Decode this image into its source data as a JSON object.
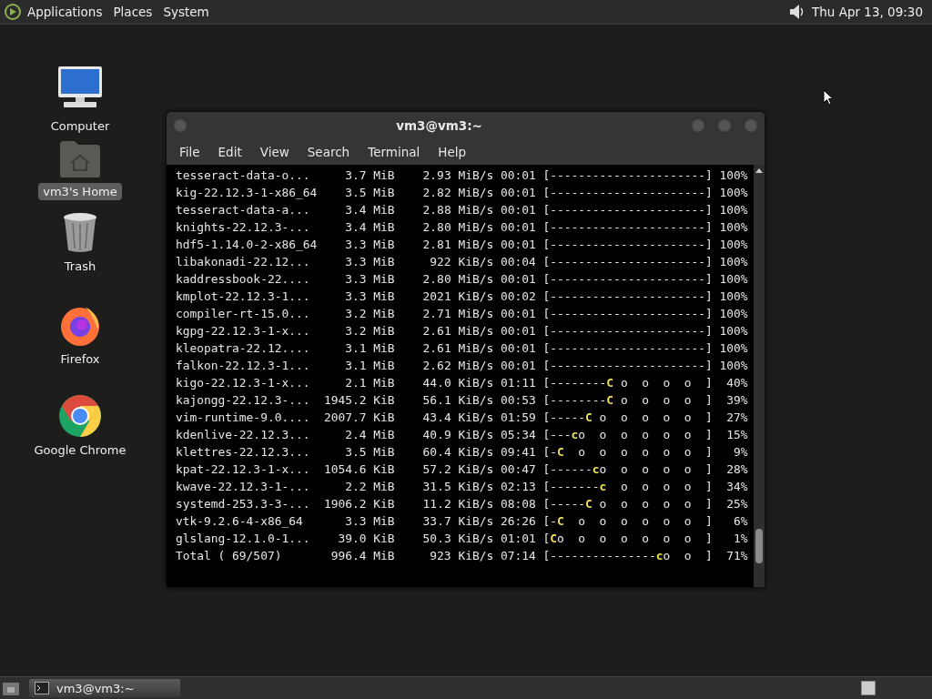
{
  "top_panel": {
    "menus": [
      "Applications",
      "Places",
      "System"
    ],
    "clock": "Thu Apr 13, 09:30"
  },
  "desktop_icons": [
    {
      "kind": "computer",
      "label": "Computer",
      "selected": false
    },
    {
      "kind": "home",
      "label": "vm3's Home",
      "selected": true
    },
    {
      "kind": "trash",
      "label": "Trash",
      "selected": false
    },
    {
      "kind": "firefox",
      "label": "Firefox",
      "selected": false
    },
    {
      "kind": "chrome",
      "label": "Google Chrome",
      "selected": false
    }
  ],
  "terminal": {
    "title": "vm3@vm3:~",
    "menus": [
      "File",
      "Edit",
      "View",
      "Search",
      "Terminal",
      "Help"
    ],
    "rows": [
      {
        "name": "tesseract-data-o...",
        "size": "3.7 MiB",
        "rate": "2.93 MiB/s",
        "eta": "00:01",
        "bar": [
          "[----------------------]"
        ],
        "percent": "100%"
      },
      {
        "name": "kig-22.12.3-1-x86_64",
        "size": "3.5 MiB",
        "rate": "2.82 MiB/s",
        "eta": "00:01",
        "bar": [
          "[----------------------]"
        ],
        "percent": "100%"
      },
      {
        "name": "tesseract-data-a...",
        "size": "3.4 MiB",
        "rate": "2.88 MiB/s",
        "eta": "00:01",
        "bar": [
          "[----------------------]"
        ],
        "percent": "100%"
      },
      {
        "name": "knights-22.12.3-...",
        "size": "3.4 MiB",
        "rate": "2.80 MiB/s",
        "eta": "00:01",
        "bar": [
          "[----------------------]"
        ],
        "percent": "100%"
      },
      {
        "name": "hdf5-1.14.0-2-x86_64",
        "size": "3.3 MiB",
        "rate": "2.81 MiB/s",
        "eta": "00:01",
        "bar": [
          "[----------------------]"
        ],
        "percent": "100%"
      },
      {
        "name": "libakonadi-22.12...",
        "size": "3.3 MiB",
        "rate": "922 KiB/s",
        "eta": "00:04",
        "bar": [
          "[----------------------]"
        ],
        "percent": "100%"
      },
      {
        "name": "kaddressbook-22....",
        "size": "3.3 MiB",
        "rate": "2.80 MiB/s",
        "eta": "00:01",
        "bar": [
          "[----------------------]"
        ],
        "percent": "100%"
      },
      {
        "name": "kmplot-22.12.3-1...",
        "size": "3.3 MiB",
        "rate": "2021 KiB/s",
        "eta": "00:02",
        "bar": [
          "[----------------------]"
        ],
        "percent": "100%"
      },
      {
        "name": "compiler-rt-15.0...",
        "size": "3.2 MiB",
        "rate": "2.71 MiB/s",
        "eta": "00:01",
        "bar": [
          "[----------------------]"
        ],
        "percent": "100%"
      },
      {
        "name": "kgpg-22.12.3-1-x...",
        "size": "3.2 MiB",
        "rate": "2.61 MiB/s",
        "eta": "00:01",
        "bar": [
          "[----------------------]"
        ],
        "percent": "100%"
      },
      {
        "name": "kleopatra-22.12....",
        "size": "3.1 MiB",
        "rate": "2.61 MiB/s",
        "eta": "00:01",
        "bar": [
          "[----------------------]"
        ],
        "percent": "100%"
      },
      {
        "name": "falkon-22.12.3-1...",
        "size": "3.1 MiB",
        "rate": "2.62 MiB/s",
        "eta": "00:01",
        "bar": [
          "[----------------------]"
        ],
        "percent": "100%"
      },
      {
        "name": "kigo-22.12.3-1-x...",
        "size": "2.1 MiB",
        "rate": "44.0 KiB/s",
        "eta": "01:11",
        "bar": [
          "[--------",
          "C",
          " o  o  o  o  ]"
        ],
        "percent": "40%"
      },
      {
        "name": "kajongg-22.12.3-...",
        "size": "1945.2 KiB",
        "rate": "56.1 KiB/s",
        "eta": "00:53",
        "bar": [
          "[--------",
          "C",
          " o  o  o  o  ]"
        ],
        "percent": "39%"
      },
      {
        "name": "vim-runtime-9.0....",
        "size": "2007.7 KiB",
        "rate": "43.4 KiB/s",
        "eta": "01:59",
        "bar": [
          "[-----",
          "C",
          " o  o  o  o  o  ]"
        ],
        "percent": "27%"
      },
      {
        "name": "kdenlive-22.12.3...",
        "size": "2.4 MiB",
        "rate": "40.9 KiB/s",
        "eta": "05:34",
        "bar": [
          "[---",
          "c",
          "o  o  o  o  o  o  ]"
        ],
        "percent": "15%"
      },
      {
        "name": "klettres-22.12.3...",
        "size": "3.5 MiB",
        "rate": "60.4 KiB/s",
        "eta": "09:41",
        "bar": [
          "[-",
          "C",
          "  o  o  o  o  o  o  ]"
        ],
        "percent": "9%"
      },
      {
        "name": "kpat-22.12.3-1-x...",
        "size": "1054.6 KiB",
        "rate": "57.2 KiB/s",
        "eta": "00:47",
        "bar": [
          "[------",
          "c",
          "o  o  o  o  o  ]"
        ],
        "percent": "28%"
      },
      {
        "name": "kwave-22.12.3-1-...",
        "size": "2.2 MiB",
        "rate": "31.5 KiB/s",
        "eta": "02:13",
        "bar": [
          "[-------",
          "c",
          "  o  o  o  o  ]"
        ],
        "percent": "34%"
      },
      {
        "name": "systemd-253.3-3-...",
        "size": "1906.2 KiB",
        "rate": "11.2 KiB/s",
        "eta": "08:08",
        "bar": [
          "[-----",
          "C",
          " o  o  o  o  o  ]"
        ],
        "percent": "25%"
      },
      {
        "name": "vtk-9.2.6-4-x86_64",
        "size": "3.3 MiB",
        "rate": "33.7 KiB/s",
        "eta": "26:26",
        "bar": [
          "[-",
          "C",
          "  o  o  o  o  o  o  ]"
        ],
        "percent": "6%"
      },
      {
        "name": "glslang-12.1.0-1...",
        "size": "39.0 KiB",
        "rate": "50.3 KiB/s",
        "eta": "01:01",
        "bar": [
          "[",
          "C",
          "o  o  o  o  o  o  o  ]"
        ],
        "percent": "1%"
      },
      {
        "name": "Total ( 69/507)",
        "size": "996.4 MiB",
        "rate": "923 KiB/s",
        "eta": "07:14",
        "bar": [
          "[---------------",
          "c",
          "o  o  ]"
        ],
        "percent": "71%"
      }
    ]
  },
  "taskbar": {
    "tasks": [
      {
        "label": "vm3@vm3:~",
        "selected": false
      }
    ]
  }
}
